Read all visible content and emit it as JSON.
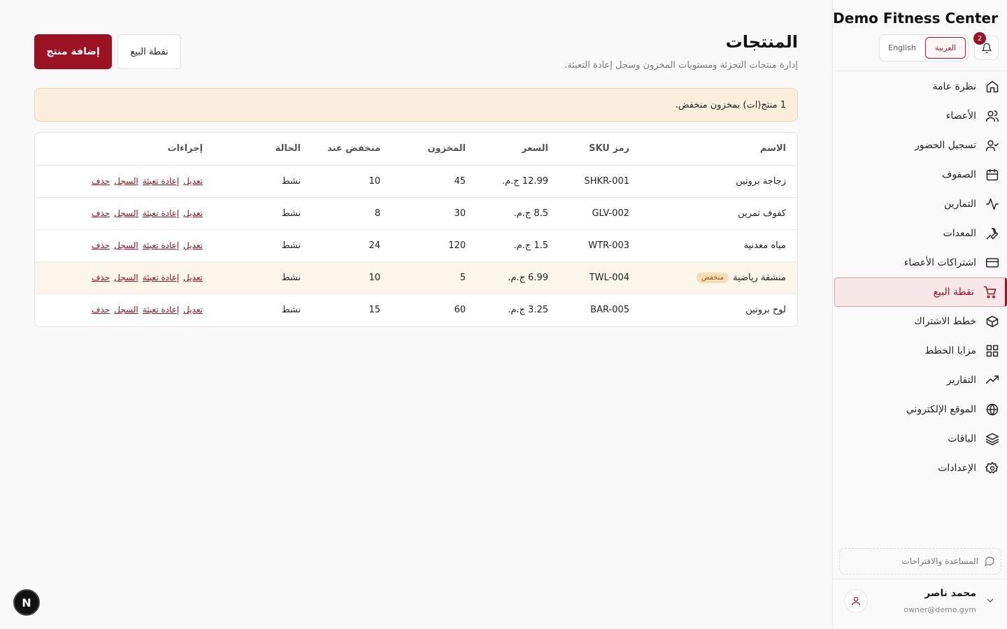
{
  "sidebar": {
    "brand": "Demo Fitness Center",
    "notifications_count": "2",
    "lang": {
      "ar": "العربية",
      "en": "English"
    },
    "items": [
      {
        "label": "نظرة عامة",
        "icon": "home-icon"
      },
      {
        "label": "الأعضاء",
        "icon": "users-icon"
      },
      {
        "label": "تسجيل الحضور",
        "icon": "user-check-icon"
      },
      {
        "label": "الصفوف",
        "icon": "calendar-icon"
      },
      {
        "label": "التمارين",
        "icon": "activity-icon"
      },
      {
        "label": "المعدات",
        "icon": "wrench-icon"
      },
      {
        "label": "اشتراكات الأعضاء",
        "icon": "credit-card-icon"
      },
      {
        "label": "نقطة البيع",
        "icon": "cart-icon"
      },
      {
        "label": "خطط الاشتراك",
        "icon": "package-icon"
      },
      {
        "label": "مزايا الخطط",
        "icon": "grid-icon"
      },
      {
        "label": "التقارير",
        "icon": "trending-up-icon"
      },
      {
        "label": "الموقع الإلكتروني",
        "icon": "globe-icon"
      },
      {
        "label": "الباقات",
        "icon": "layers-icon"
      },
      {
        "label": "الإعدادات",
        "icon": "gear-icon"
      }
    ],
    "active_index": 7,
    "help_label": "المساعدة والاقتراحات",
    "user": {
      "name": "محمد ناصر",
      "email": "owner@demo.gym"
    }
  },
  "header": {
    "title": "المنتجات",
    "subtitle": "إدارة منتجات التجزئة ومستويات المخزون وسجل إعادة التعبئة.",
    "add_label": "إضافة منتج",
    "pos_label": "نقطة البيع"
  },
  "alert": {
    "text": "1 منتج(ات) بمخزون منخفض."
  },
  "table": {
    "columns": [
      "الاسم",
      "رمز SKU",
      "السعر",
      "المخزون",
      "منخفض عند",
      "الحالة",
      "إجراءات"
    ],
    "low_badge": "منخفض",
    "actions": {
      "edit": "تعديل",
      "restock": "إعادة تعبئة",
      "log": "السجل",
      "delete": "حذف"
    },
    "rows": [
      {
        "name": "زجاجة بروتين",
        "sku": "SHKR-001",
        "price": "12.99 ج.م.",
        "stock": "45",
        "low_at": "10",
        "status": "نشط",
        "low": false
      },
      {
        "name": "كفوف تمرين",
        "sku": "GLV-002",
        "price": "8.5 ج.م.",
        "stock": "30",
        "low_at": "8",
        "status": "نشط",
        "low": false
      },
      {
        "name": "مياه معدنية",
        "sku": "WTR-003",
        "price": "1.5 ج.م.",
        "stock": "120",
        "low_at": "24",
        "status": "نشط",
        "low": false
      },
      {
        "name": "منشفة رياضية",
        "sku": "TWL-004",
        "price": "6.99 ج.م.",
        "stock": "5",
        "low_at": "10",
        "status": "نشط",
        "low": true
      },
      {
        "name": "لوح بروتين",
        "sku": "BAR-005",
        "price": "3.25 ج.م.",
        "stock": "60",
        "low_at": "15",
        "status": "نشط",
        "low": false
      }
    ]
  },
  "dev_badge": "N",
  "colors": {
    "accent": "#9b1222",
    "alert_bg": "#fbeedc",
    "low_row_bg": "#fbf5ea"
  }
}
